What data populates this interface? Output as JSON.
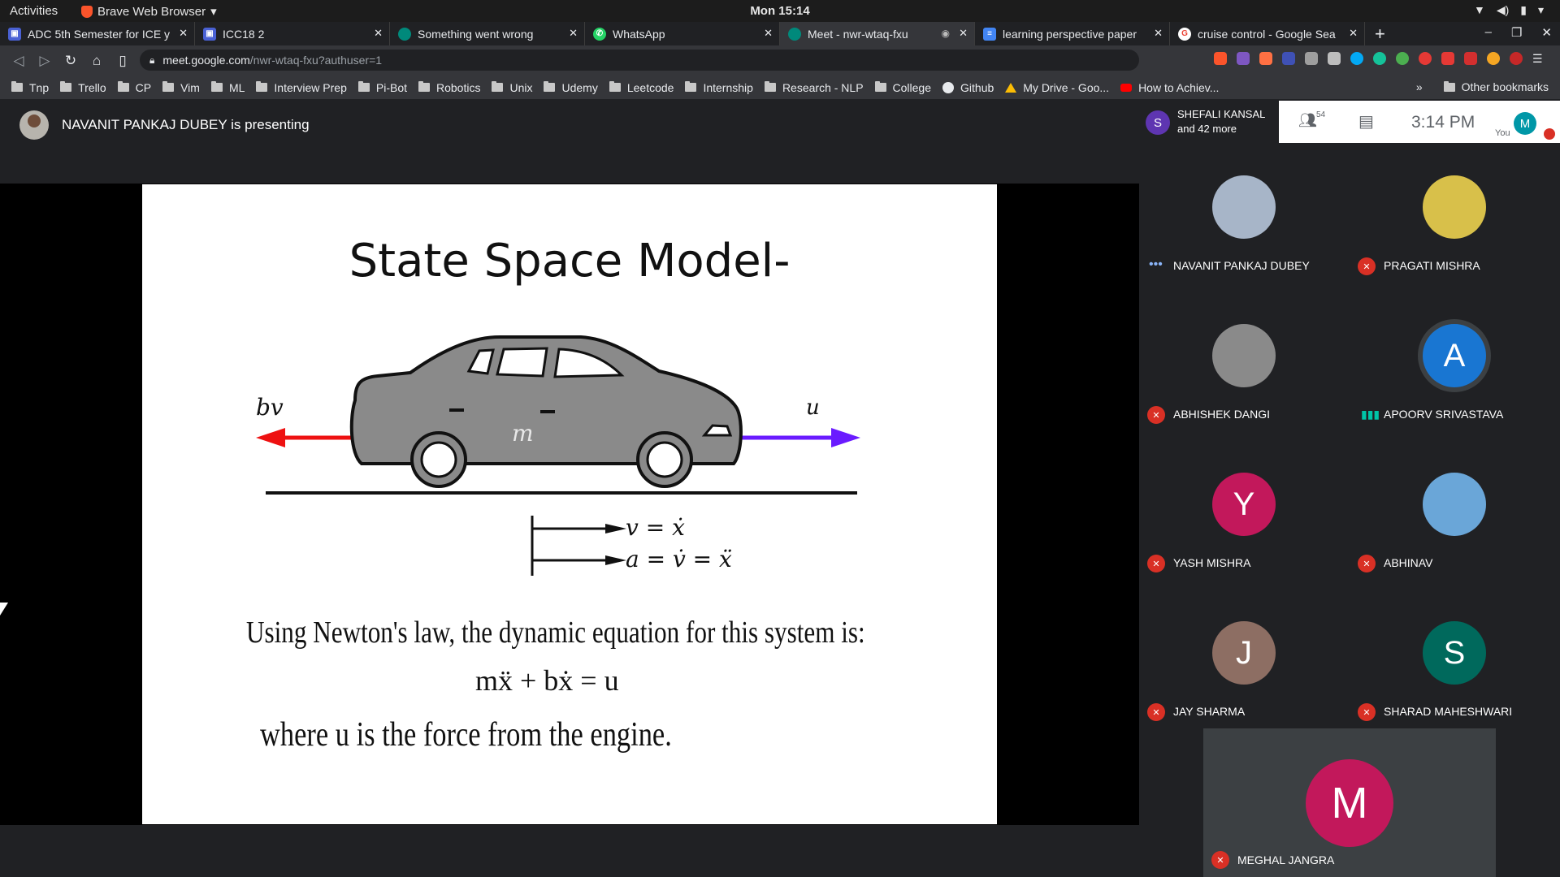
{
  "system": {
    "activities": "Activities",
    "app_name": "Brave Web Browser",
    "clock": "Mon 15:14"
  },
  "tabs": [
    {
      "title": "ADC 5th Semester for ICE y",
      "icon": "classroom-icon",
      "color": "#4a61d4"
    },
    {
      "title": "ICC18 2",
      "icon": "classroom-icon",
      "color": "#4a61d4"
    },
    {
      "title": "Something went wrong",
      "icon": "meet-icon",
      "color": "#00897b"
    },
    {
      "title": "WhatsApp",
      "icon": "whatsapp-icon",
      "color": "#25d366"
    },
    {
      "title": "Meet - nwr-wtaq-fxu",
      "icon": "meet-icon",
      "color": "#00897b"
    },
    {
      "title": "learning perspective paper",
      "icon": "docs-icon",
      "color": "#4285f4"
    },
    {
      "title": "cruise control - Google Sea",
      "icon": "google-icon",
      "color": "#ea4335"
    }
  ],
  "omnibox": {
    "domain": "meet.google.com",
    "path": "/nwr-wtaq-fxu?authuser=1"
  },
  "bookmarks": [
    {
      "label": "Tnp"
    },
    {
      "label": "Trello"
    },
    {
      "label": "CP"
    },
    {
      "label": "Vim"
    },
    {
      "label": "ML"
    },
    {
      "label": "Interview Prep"
    },
    {
      "label": "Pi-Bot"
    },
    {
      "label": "Robotics"
    },
    {
      "label": "Unix"
    },
    {
      "label": "Udemy"
    },
    {
      "label": "Leetcode"
    },
    {
      "label": "Internship"
    },
    {
      "label": "Research - NLP"
    },
    {
      "label": "College"
    },
    {
      "label": "Github"
    },
    {
      "label": "My Drive - Goo..."
    },
    {
      "label": "How to Achiev..."
    }
  ],
  "other_bookmarks": "Other bookmarks",
  "meet": {
    "presenter_text": "NAVANIT PANKAJ DUBEY is presenting",
    "header_name": "SHEFALI KANSAL",
    "header_more": "and 42 more",
    "header_initial": "S",
    "people_count": "54",
    "time": "3:14 PM",
    "you_initial": "M",
    "you_label": "You"
  },
  "slide": {
    "title": "State Space Model-",
    "label_left": "bv",
    "label_right": "u",
    "label_mass": "m",
    "eq_v": "v = ẋ",
    "eq_a": "a = v̇ = ẍ",
    "newton_text": "Using Newton's law, the dynamic equation for this system is:",
    "dynamic_equation": "mẍ + bẋ = u",
    "where_text": "where u is the force from the engine."
  },
  "participants": [
    {
      "name": "NAVANIT PANKAJ DUBEY",
      "initial": "",
      "color": "#a7b5c8",
      "status": "speaking-dots"
    },
    {
      "name": "PRAGATI MISHRA",
      "initial": "",
      "color": "#d8c04a",
      "status": "muted"
    },
    {
      "name": "ABHISHEK DANGI",
      "initial": "",
      "color": "#8a8a8a",
      "status": "muted"
    },
    {
      "name": "APOORV SRIVASTAVA",
      "initial": "A",
      "color": "#1976d2",
      "status": "speaking"
    },
    {
      "name": "YASH MISHRA",
      "initial": "Y",
      "color": "#c2185b",
      "status": "muted"
    },
    {
      "name": "ABHINAV",
      "initial": "",
      "color": "#6aa6d8",
      "status": "muted"
    },
    {
      "name": "JAY SHARMA",
      "initial": "J",
      "color": "#8d6e63",
      "status": "muted"
    },
    {
      "name": "SHARAD MAHESHWARI",
      "initial": "S",
      "color": "#00695c",
      "status": "muted"
    }
  ],
  "last_participant": {
    "name": "MEGHAL JANGRA",
    "initial": "M"
  }
}
